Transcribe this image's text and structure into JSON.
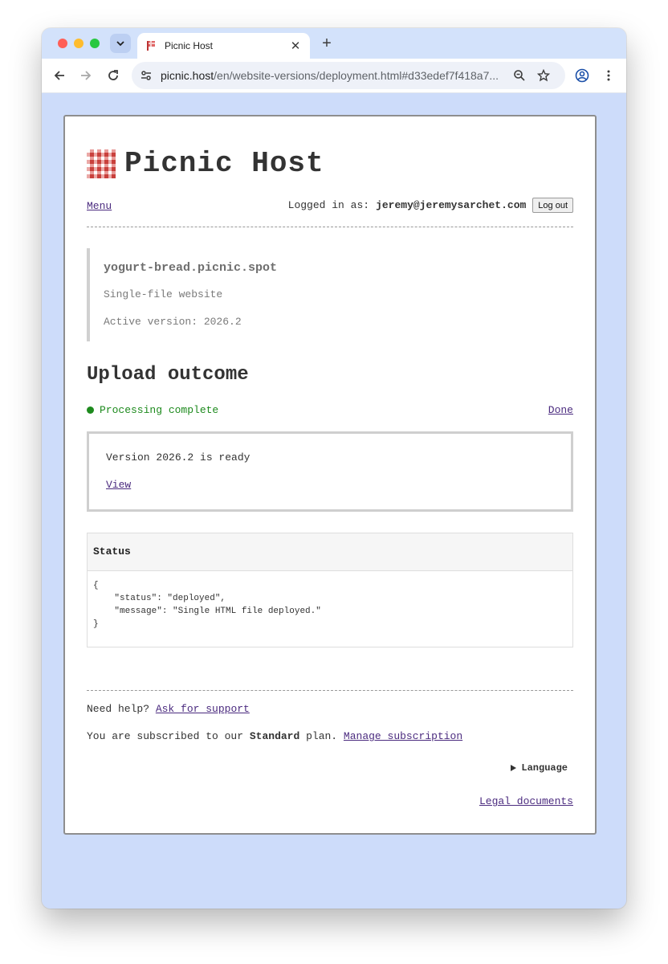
{
  "browser": {
    "tab_title": "Picnic Host",
    "url_host": "picnic.host",
    "url_path": "/en/website-versions/deployment.html#d33edef7f418a7..."
  },
  "header": {
    "site_title": "Picnic Host",
    "menu_label": "Menu",
    "logged_in_label": "Logged in as:",
    "user_email": "jeremy@jeremysarchet.com",
    "logout_label": "Log out"
  },
  "site": {
    "name": "yogurt-bread.picnic.spot",
    "type": "Single-file website",
    "active_version": "Active version: 2026.2"
  },
  "upload": {
    "heading": "Upload outcome",
    "status_text": "Processing complete",
    "done_label": "Done",
    "ready_text": "Version 2026.2 is ready",
    "view_label": "View"
  },
  "status_panel": {
    "title": "Status",
    "json": "{\n    \"status\": \"deployed\",\n    \"message\": \"Single HTML file deployed.\"\n}"
  },
  "footer": {
    "help_label": "Need help?",
    "support_link": "Ask for support",
    "sub_prefix": "You are subscribed to our",
    "plan_name": "Standard",
    "sub_suffix": "plan.",
    "manage_link": "Manage subscription",
    "language_label": "Language",
    "legal_link": "Legal documents"
  },
  "colors": {
    "page_bg": "#cddcfa",
    "link": "#4b2b7f",
    "success": "#1d8a1d",
    "logo_red": "#d9534f"
  }
}
